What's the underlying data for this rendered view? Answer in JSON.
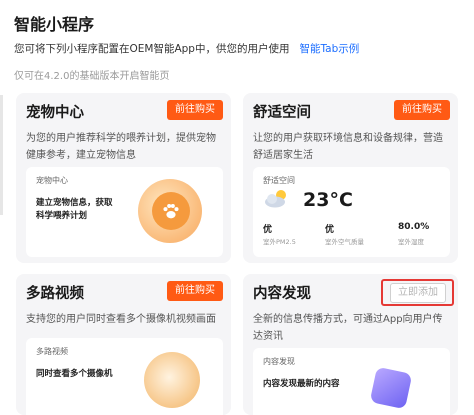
{
  "page": {
    "title": "智能小程序",
    "description": "您可将下列小程序配置在OEM智能App中，供您的用户使用",
    "example_link": "智能Tab示例",
    "version_note": "仅可在4.2.0的基础版本开启智能页"
  },
  "cards": {
    "pet": {
      "title": "宠物中心",
      "button": "前往购买",
      "desc_line1": "为您的用户推荐科学的喂养计划，提供宠物",
      "desc_line2": "健康参考，建立宠物信息",
      "preview_label": "宠物中心",
      "preview_line1": "建立宠物信息，获取",
      "preview_line2": "科学喂养计划",
      "icon": "paw-icon"
    },
    "space": {
      "title": "舒适空间",
      "button": "前往购买",
      "desc_line1": "让您的用户获取环境信息和设备规律，营造",
      "desc_line2": "舒适居家生活",
      "preview_label": "舒适空间",
      "temperature": "23°C",
      "metrics": [
        {
          "value": "优",
          "label": "室外PM2.5"
        },
        {
          "value": "优",
          "label": "室外空气质量"
        },
        {
          "value": "80.0%",
          "label": "室外湿度"
        }
      ],
      "icon": "cloud-sun-icon"
    },
    "video": {
      "title": "多路视频",
      "button": "前往购买",
      "desc_line1": "支持您的用户同时查看多个摄像机视频画面",
      "preview_label": "多路视频",
      "preview_line1": "同时查看多个摄像机",
      "icon": "camera-icon"
    },
    "discover": {
      "title": "内容发现",
      "button": "立即添加",
      "desc_line1": "全新的信息传播方式，可通过App向用户传",
      "desc_line2": "达资讯",
      "preview_label": "内容发现",
      "preview_line1": "内容发现最新的内容",
      "icon": "discover-icon"
    }
  },
  "colors": {
    "accent": "#ff5a14",
    "link": "#1e6fff",
    "highlight": "#e53935",
    "card_bg": "#f5f5f7"
  }
}
